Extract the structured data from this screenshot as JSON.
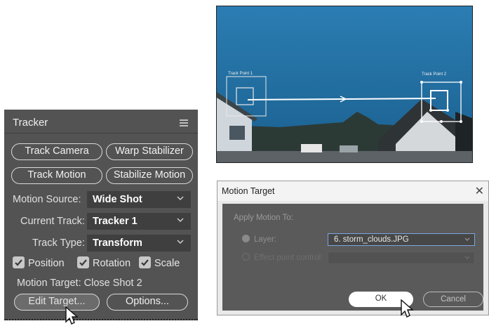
{
  "tracker": {
    "title": "Tracker",
    "buttons": {
      "track_camera": "Track Camera",
      "warp_stabilizer": "Warp Stabilizer",
      "track_motion": "Track Motion",
      "stabilize_motion": "Stabilize Motion",
      "edit_target": "Edit Target...",
      "options": "Options..."
    },
    "motion_source": {
      "label": "Motion Source:",
      "value": "Wide Shot"
    },
    "current_track": {
      "label": "Current Track:",
      "value": "Tracker 1"
    },
    "track_type": {
      "label": "Track Type:",
      "value": "Transform"
    },
    "checkboxes": {
      "position": "Position",
      "rotation": "Rotation",
      "scale": "Scale"
    },
    "motion_target": "Motion Target: Close Shot 2"
  },
  "video": {
    "track_point_1": "Track Point 1",
    "track_point_2": "Track Point 2"
  },
  "dialog": {
    "title": "Motion Target",
    "close": "✕",
    "section": "Apply Motion To:",
    "layer_label": "Layer:",
    "layer_value": "6. storm_clouds.JPG",
    "effect_label": "Effect point control:",
    "ok": "OK",
    "cancel": "Cancel"
  },
  "colors": {
    "panel_bg": "#535353",
    "dropdown_bg": "#3f3f3f",
    "dialog_body": "#5a5a5a",
    "sky": "#1f6fa3"
  }
}
